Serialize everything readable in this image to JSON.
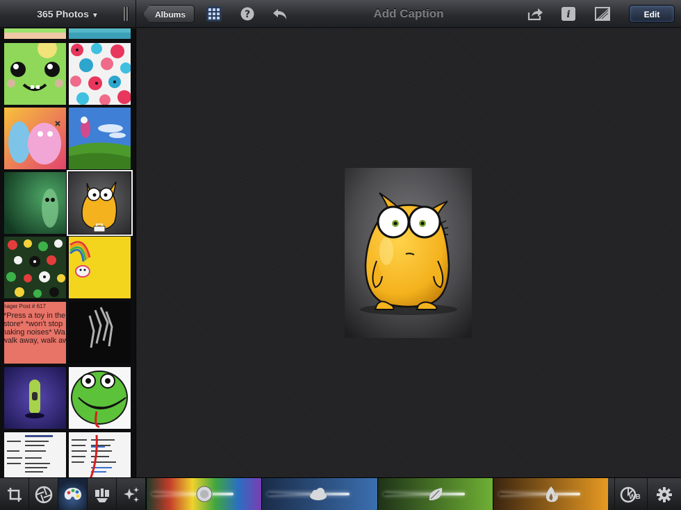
{
  "topbar": {
    "album_title": "365 Photos",
    "albums_button": "Albums",
    "caption_placeholder": "Add Caption",
    "edit_button": "Edit"
  },
  "sidebar": {
    "thumbnails": [
      {
        "name": "thumb-partial-1"
      },
      {
        "name": "thumb-partial-2"
      },
      {
        "name": "thumb-green-monster"
      },
      {
        "name": "thumb-pattern"
      },
      {
        "name": "thumb-ugly-dolls"
      },
      {
        "name": "thumb-hills"
      },
      {
        "name": "thumb-green-dark"
      },
      {
        "name": "thumb-yellow-monster",
        "selected": true
      },
      {
        "name": "thumb-skull-pattern"
      },
      {
        "name": "thumb-rainbow"
      },
      {
        "name": "thumb-text-post",
        "lines": [
          "nager Post # 617",
          "*Press a toy in the",
          "store* *won't stop",
          "naking noises* Wa",
          "walk away, walk away."
        ]
      },
      {
        "name": "thumb-dark-streaks"
      },
      {
        "name": "thumb-purple-figure"
      },
      {
        "name": "thumb-green-creature"
      },
      {
        "name": "thumb-doc-1"
      },
      {
        "name": "thumb-doc-2"
      }
    ]
  },
  "bottombar": {
    "tools": [
      "crop-icon",
      "aperture-icon",
      "palette-icon",
      "brush-icon",
      "sparkle-icon"
    ],
    "wb_label": "WB",
    "sliders": [
      {
        "name": "exposure-slider",
        "colors": [
          "#1f3b2a",
          "#c43c2a",
          "#f0d22d",
          "#3fa63f",
          "#2b6fc2",
          "#7a3db3"
        ]
      },
      {
        "name": "cloud-slider",
        "colors": [
          "#1a2c48",
          "#3b6fb0"
        ]
      },
      {
        "name": "leaf-slider",
        "colors": [
          "#1e3218",
          "#6fb034"
        ]
      },
      {
        "name": "flame-slider",
        "colors": [
          "#3a2410",
          "#e79a22"
        ]
      }
    ]
  },
  "colors": {
    "accent": "#3c5f93",
    "monster_body": "#f4b21e",
    "canvas_bg": "#232325"
  }
}
